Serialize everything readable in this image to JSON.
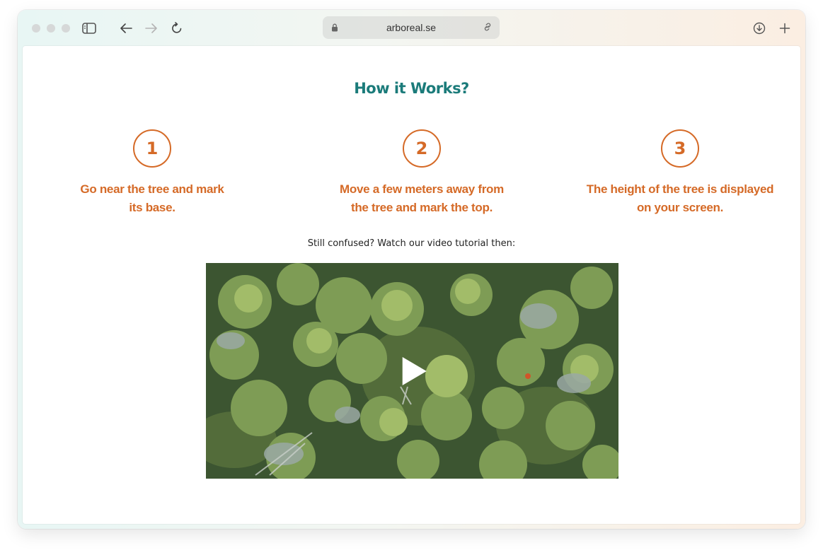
{
  "browser": {
    "url": "arboreal.se",
    "icons": {
      "sidebar": "sidebar-icon",
      "back": "arrow-left-icon",
      "forward": "arrow-right-icon",
      "reload": "reload-icon",
      "lock": "lock-icon",
      "link": "link-icon",
      "download": "download-icon",
      "new_tab": "plus-icon"
    }
  },
  "page": {
    "title": "How it Works?",
    "steps": [
      {
        "number": "1",
        "line1": "Go near the tree and mark",
        "line2": "its base."
      },
      {
        "number": "2",
        "line1": "Move a few meters away from",
        "line2": "the tree and mark the top."
      },
      {
        "number": "3",
        "line1": "The height of the tree is displayed",
        "line2": "on your screen."
      }
    ],
    "video_caption": "Still confused? Watch our video tutorial then:"
  },
  "colors": {
    "title": "#1b7b7a",
    "accent": "#d56a27",
    "forest": "#3f5a34"
  }
}
